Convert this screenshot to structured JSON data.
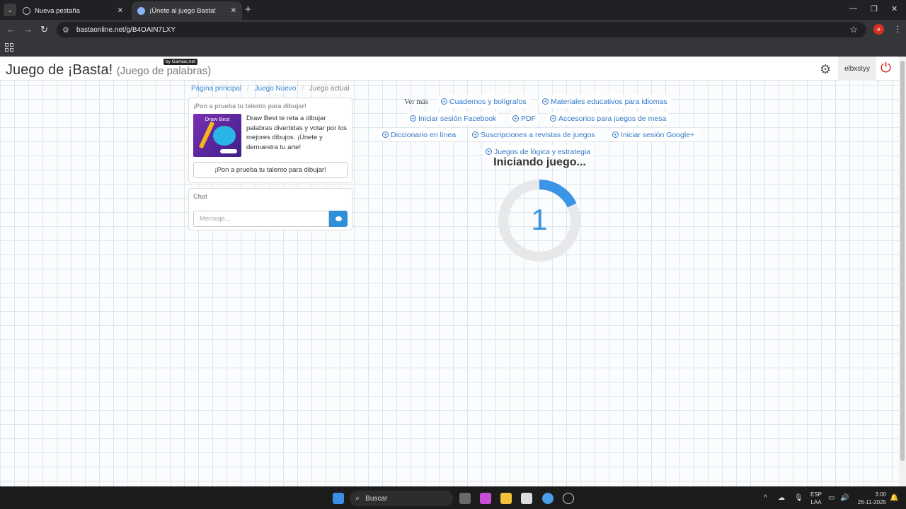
{
  "browser": {
    "tabs": [
      {
        "title": "Nueva pestaña"
      },
      {
        "title": "¡Únete al juego Basta!"
      }
    ],
    "url": "bastaonline.net/g/B4OAIN7LXY",
    "profile_initial": "e"
  },
  "header": {
    "title": "Juego de ¡Basta!",
    "subtitle": "(Juego de palabras)",
    "badge": "by Gamiac.net",
    "username": "elbxstyy"
  },
  "breadcrumb": {
    "home": "Página principal",
    "new_game": "Juego Nuevo",
    "current": "Juego actual"
  },
  "promo": {
    "title": "¡Pon a prueba tu talento para dibujar!",
    "image_label": "Draw Best",
    "text": "Draw Best te reta a dibujar palabras divertidas y votar por los mejores dibujos. ¡Únete y demuestra tu arte!",
    "button": "¡Pon a prueba tu talento para dibujar!"
  },
  "chat": {
    "title": "Chat",
    "placeholder": "Mensaje..."
  },
  "links": {
    "ver_mas": "Ver más",
    "items": [
      "Cuadernos y bolígrafos",
      "Materiales educativos para idiomas",
      "Iniciar sesión Facebook",
      "PDF",
      "Accesorios para juegos de mesa",
      "Diccionario en línea",
      "Suscripciones a revistas de juegos",
      "Iniciar sesión Google+",
      "Juegos de lógica y estrategia"
    ]
  },
  "game": {
    "status": "Iniciando juego...",
    "countdown": "1",
    "progress_fraction": 0.18,
    "ring_color": "#3b95e4",
    "track_color": "#e6e8ea"
  },
  "taskbar": {
    "search": "Buscar",
    "lang_1": "ESP",
    "lang_2": "LAA",
    "time": "3:00",
    "date": "26-11-2025"
  }
}
